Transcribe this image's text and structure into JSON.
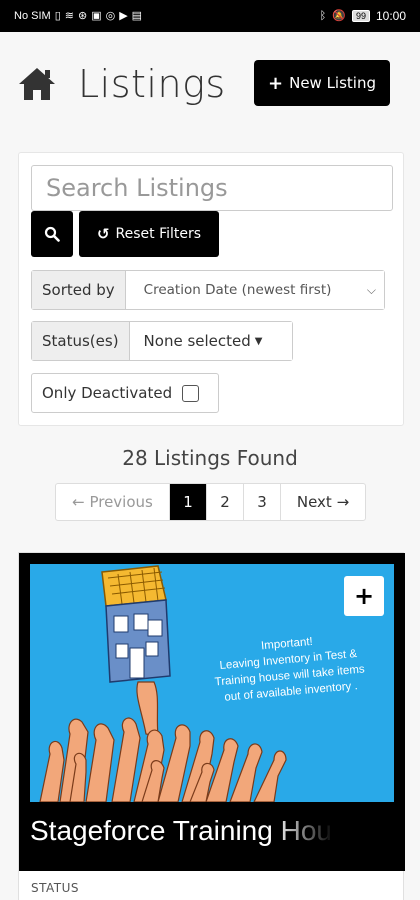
{
  "statusbar": {
    "carrier": "No SIM",
    "battery": "99",
    "time": "10:00"
  },
  "header": {
    "title": "Listings",
    "new_listing_label": "New Listing"
  },
  "filters": {
    "search_placeholder": "Search Listings",
    "reset_label": "Reset Filters",
    "sorted_by_label": "Sorted by",
    "sorted_by_value": "Creation Date (newest first)",
    "status_label": "Status(es)",
    "status_value": "None selected",
    "only_deactivated_label": "Only Deactivated",
    "only_deactivated_checked": false
  },
  "results": {
    "count_text": "28 Listings Found"
  },
  "pagination": {
    "previous_label": "← Previous",
    "pages": [
      "1",
      "2",
      "3"
    ],
    "active_page": "1",
    "next_label": "Next →"
  },
  "listing": {
    "image_note_lines": [
      "Important!",
      "Leaving Inventory in Test &",
      "Training house will take items",
      "out of available inventory ."
    ],
    "title": "Stageforce Training House",
    "status_label": "STATUS"
  },
  "colors": {
    "accent": "#000000",
    "image_background": "#29a9e8"
  }
}
